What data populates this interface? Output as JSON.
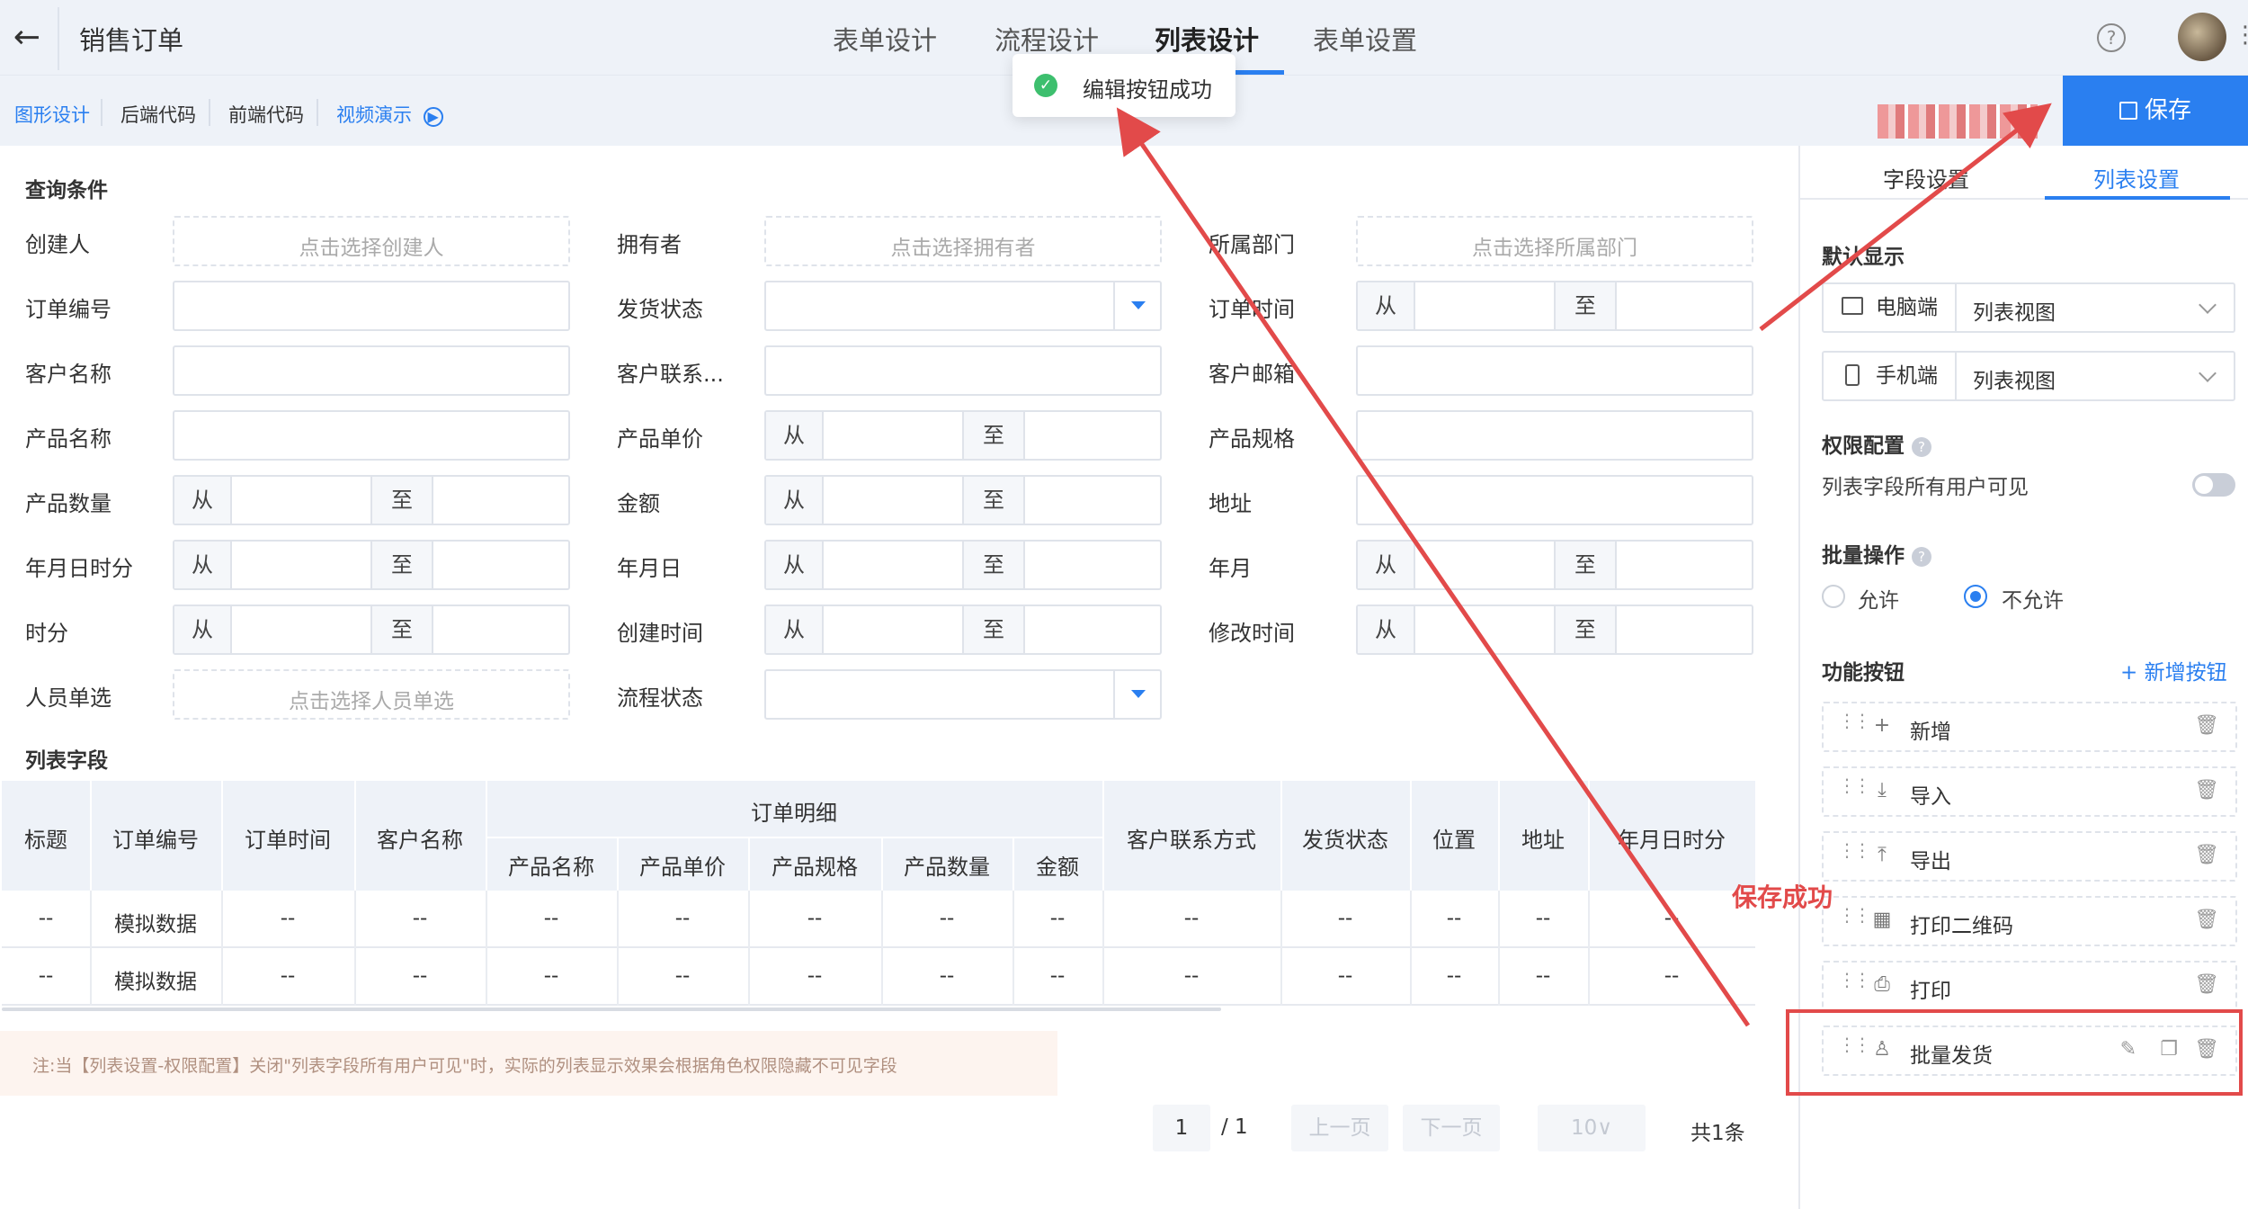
{
  "header": {
    "back_icon": "arrow-left-icon",
    "title": "销售订单",
    "tabs": [
      {
        "label": "表单设计",
        "active": false
      },
      {
        "label": "流程设计",
        "active": false
      },
      {
        "label": "列表设计",
        "active": true
      },
      {
        "label": "表单设置",
        "active": false
      }
    ],
    "help_glyph": "?"
  },
  "subbar": {
    "links": [
      "图形设计",
      "后端代码",
      "前端代码",
      "视频演示"
    ],
    "video_glyph": "▶",
    "save_label": "保存"
  },
  "toast": {
    "check": "✓",
    "text": "编辑按钮成功"
  },
  "query": {
    "title": "查询条件",
    "from": "从",
    "to": "至",
    "fields": {
      "creator": {
        "label": "创建人",
        "placeholder": "点击选择创建人"
      },
      "owner": {
        "label": "拥有者",
        "placeholder": "点击选择拥有者"
      },
      "dept": {
        "label": "所属部门",
        "placeholder": "点击选择所属部门"
      },
      "order_no": {
        "label": "订单编号"
      },
      "ship_status": {
        "label": "发货状态"
      },
      "order_time": {
        "label": "订单时间"
      },
      "customer": {
        "label": "客户名称"
      },
      "contact": {
        "label": "客户联系..."
      },
      "email": {
        "label": "客户邮箱"
      },
      "product": {
        "label": "产品名称"
      },
      "price": {
        "label": "产品单价"
      },
      "spec": {
        "label": "产品规格"
      },
      "qty": {
        "label": "产品数量"
      },
      "amount": {
        "label": "金额"
      },
      "address": {
        "label": "地址"
      },
      "ymdhm": {
        "label": "年月日时分"
      },
      "ymd": {
        "label": "年月日"
      },
      "ym": {
        "label": "年月"
      },
      "hm": {
        "label": "时分"
      },
      "created_time": {
        "label": "创建时间"
      },
      "modified_time": {
        "label": "修改时间"
      },
      "person": {
        "label": "人员单选",
        "placeholder": "点击选择人员单选"
      },
      "flow_status": {
        "label": "流程状态"
      }
    }
  },
  "list": {
    "title": "列表字段",
    "group_header": "订单明细",
    "columns": [
      "标题",
      "订单编号",
      "订单时间",
      "客户名称",
      "产品名称",
      "产品单价",
      "产品规格",
      "产品数量",
      "金额",
      "客户联系方式",
      "发货状态",
      "位置",
      "地址",
      "年月日时分"
    ],
    "rows": [
      [
        "--",
        "模拟数据",
        "--",
        "--",
        "--",
        "--",
        "--",
        "--",
        "--",
        "--",
        "--",
        "--",
        "--",
        "--"
      ],
      [
        "--",
        "模拟数据",
        "--",
        "--",
        "--",
        "--",
        "--",
        "--",
        "--",
        "--",
        "--",
        "--",
        "--",
        "--"
      ]
    ]
  },
  "note": "注:当【列表设置-权限配置】关闭\"列表字段所有用户可见\"时，实际的列表显示效果会根据角色权限隐藏不可见字段",
  "pager": {
    "page": "1",
    "sep": "/ 1",
    "prev": "上一页",
    "next": "下一页",
    "size": "10∨",
    "total": "共1条"
  },
  "right_panel": {
    "tabs": [
      "字段设置",
      "列表设置"
    ],
    "default_display": {
      "title": "默认显示",
      "pc": {
        "device": "电脑端",
        "value": "列表视图"
      },
      "mobile": {
        "device": "手机端",
        "value": "列表视图"
      }
    },
    "permission": {
      "title": "权限配置",
      "text": "列表字段所有用户可见",
      "enabled": false
    },
    "batch": {
      "title": "批量操作",
      "allow": "允许",
      "deny": "不允许",
      "selected": "不允许"
    },
    "buttons": {
      "title": "功能按钮",
      "add_label": "+ 新增按钮",
      "items": [
        {
          "label": "新增",
          "icon": "plus-icon",
          "glyph": "+"
        },
        {
          "label": "导入",
          "icon": "import-icon",
          "glyph": "⤓"
        },
        {
          "label": "导出",
          "icon": "export-icon",
          "glyph": "⤒"
        },
        {
          "label": "打印二维码",
          "icon": "qrcode-icon",
          "glyph": "▦"
        },
        {
          "label": "打印",
          "icon": "printer-icon",
          "glyph": "⎙"
        },
        {
          "label": "批量发货",
          "icon": "user-icon",
          "glyph": "♙"
        }
      ]
    }
  },
  "annotation": {
    "label": "保存成功",
    "color": "#e24a4a"
  },
  "colors": {
    "accent": "#2a7ff0",
    "success": "#3dbf6e",
    "annotation": "#e24a4a"
  }
}
